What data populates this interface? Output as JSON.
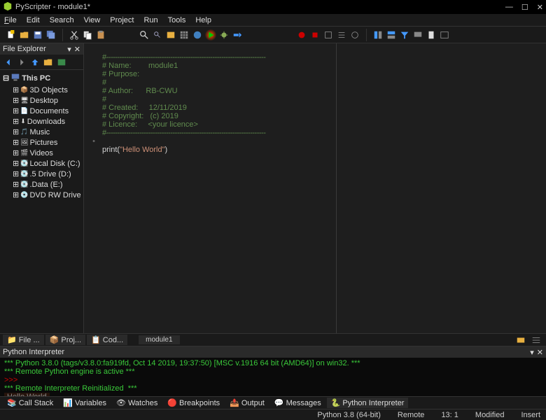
{
  "window": {
    "title": "PyScripter - module1*",
    "min": "—",
    "max": "☐",
    "close": "✕"
  },
  "menu": {
    "file": "File",
    "edit": "Edit",
    "search": "Search",
    "view": "View",
    "project": "Project",
    "run": "Run",
    "tools": "Tools",
    "help": "Help"
  },
  "explorer": {
    "title": "File Explorer",
    "root": "This PC",
    "items": [
      {
        "label": "3D Objects"
      },
      {
        "label": "Desktop"
      },
      {
        "label": "Documents"
      },
      {
        "label": "Downloads"
      },
      {
        "label": "Music"
      },
      {
        "label": "Pictures"
      },
      {
        "label": "Videos"
      },
      {
        "label": "Local Disk (C:)"
      },
      {
        "label": ".5 Drive (D:)"
      },
      {
        "label": ".Data (E:)"
      },
      {
        "label": "DVD RW Drive (G:)"
      }
    ]
  },
  "tabs": {
    "left": [
      {
        "label": "File ..."
      },
      {
        "label": "Proj..."
      },
      {
        "label": "Cod..."
      }
    ],
    "editor": "module1"
  },
  "code": {
    "dash": "#------------------------------------------------------------------------",
    "l1": "# Name:        module1",
    "l2": "# Purpose:",
    "l3": "#",
    "l4": "# Author:      RB-CWU",
    "l5": "#",
    "l6": "# Created:     12/11/2019",
    "l7": "# Copyright:   (c) 2019",
    "l8": "# Licence:     <your licence>",
    "prn": "print(",
    "str": "\"Hello World\"",
    "close": ")"
  },
  "interp": {
    "title": "Python Interpreter",
    "l1": "*** Python 3.8.0 (tags/v3.8.0:fa919fd, Oct 14 2019, 19:37:50) [MSC v.1916 64 bit (AMD64)] on win32. ***",
    "l2": "*** Remote Python engine is active ***",
    "p": ">>>",
    "l3": "*** Remote Interpreter Reinitialized  ***",
    "out": "Hello World"
  },
  "btabs": {
    "callstack": "Call Stack",
    "variables": "Variables",
    "watches": "Watches",
    "breakpoints": "Breakpoints",
    "output": "Output",
    "messages": "Messages",
    "python": "Python Interpreter"
  },
  "status": {
    "python": "Python 3.8 (64-bit)",
    "remote": "Remote",
    "cursor": "13: 1",
    "modified": "Modified",
    "mode": "Insert"
  }
}
